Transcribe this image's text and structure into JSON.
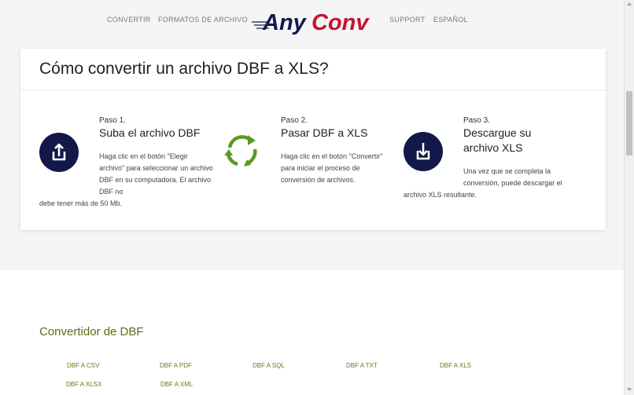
{
  "nav": {
    "convert": "CONVERTIR",
    "formats": "FORMATOS DE ARCHIVO",
    "support": "SUPPORT",
    "language": "ESPAÑOL"
  },
  "logo": {
    "part1": "Any",
    "part2": "Conv",
    "dark_color": "#13174a",
    "accent_color": "#c8102e"
  },
  "how_to": {
    "title": "Cómo convertir un archivo DBF a XLS?",
    "steps": [
      {
        "num": "Paso 1.",
        "title": "Suba el archivo DBF",
        "desc": "Haga clic en el botón \"Elegir archivo\" para seleccionar un archivo DBF en su computadora. El archivo DBF no debe tener más de 50 Mb.",
        "icon": "upload-icon"
      },
      {
        "num": "Paso 2.",
        "title": "Pasar DBF a XLS",
        "desc": "Haga clic en el botón \"Convertir\" para iniciar el proceso de conversión de archivos.",
        "icon": "refresh-cycle-icon"
      },
      {
        "num": "Paso 3.",
        "title": "Descargue su archivo XLS",
        "desc": "Una vez que se completa la conversión, puede descargar el archivo XLS resultante.",
        "icon": "download-icon"
      }
    ]
  },
  "converter": {
    "title": "Convertidor de DBF",
    "links": [
      "DBF A CSV",
      "DBF A PDF",
      "DBF A SQL",
      "DBF A TXT",
      "DBF A XLS",
      "DBF A XLSX",
      "DBF A XML"
    ]
  },
  "colors": {
    "icon_bg": "#13174a",
    "cycle_green": "#5a9a1f",
    "link_green": "#6a7a1e"
  }
}
